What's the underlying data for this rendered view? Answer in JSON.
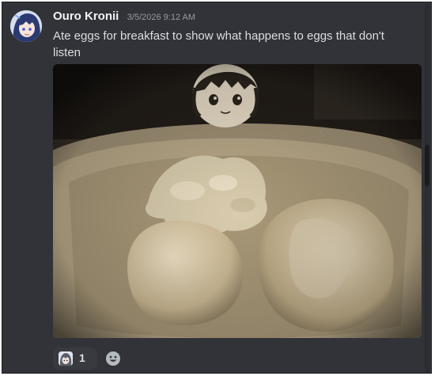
{
  "message": {
    "username": "Ouro Kronii",
    "timestamp": "3/5/2026 9:12 AM",
    "text": "Ate eggs for breakfast to show what happens to eggs that don't listen",
    "avatar_icon": "kronii-avatar",
    "username_color": "#f2f3f5",
    "text_color": "#dbdee1",
    "timestamp_color": "#949ba4"
  },
  "attachment": {
    "icon": "photo-eggs-with-face-drawing",
    "tone": "sepia"
  },
  "reactions": [
    {
      "emoji_icon": "kronii-emoji",
      "count": "1"
    }
  ],
  "add_reaction": {
    "icon": "smiley-face-icon"
  },
  "theme": {
    "background": "#313338",
    "reaction_bg": "#383a40"
  }
}
